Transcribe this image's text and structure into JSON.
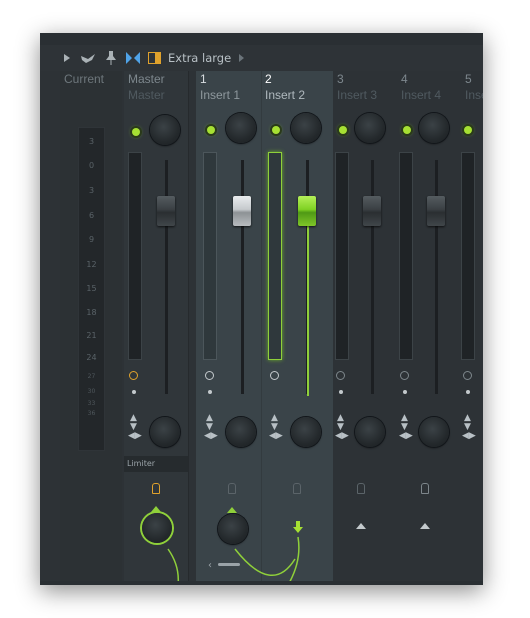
{
  "toolbar": {
    "icons": [
      "play-arrow-icon",
      "bird-icon",
      "pin-icon",
      "bowtie-icon",
      "panel-icon",
      "next-arrow-icon"
    ],
    "size_label": "Extra large"
  },
  "current": {
    "label": "Current",
    "scale": [
      "3",
      "0",
      "3",
      "6",
      "9",
      "12",
      "15",
      "18",
      "21",
      "24",
      "27",
      "30",
      "33",
      "36"
    ]
  },
  "master": {
    "number": "Master",
    "name": "Master",
    "fx_label": "Limiter"
  },
  "inserts": [
    {
      "number": "1",
      "name": "Insert 1"
    },
    {
      "number": "2",
      "name": "Insert 2"
    },
    {
      "number": "3",
      "name": "Insert 3"
    },
    {
      "number": "4",
      "name": "Insert 4"
    },
    {
      "number": "5",
      "name": "Inse"
    }
  ],
  "colors": {
    "accent_green": "#8fd03a",
    "selected_fill": "#3a4449",
    "led_green": "#a6e033",
    "orange": "#e0a22c"
  }
}
